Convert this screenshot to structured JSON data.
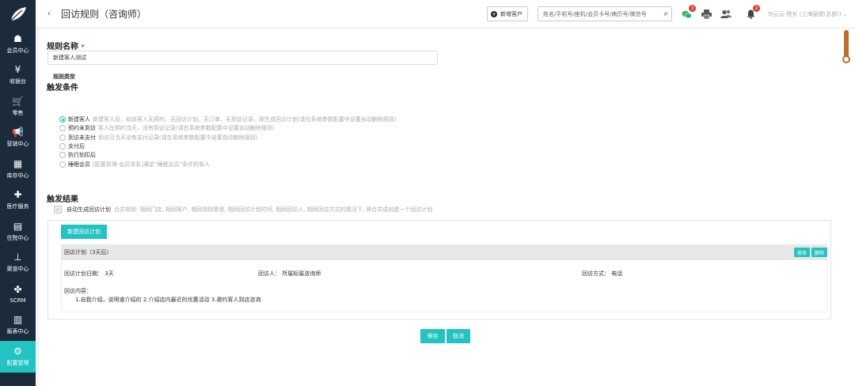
{
  "header": {
    "title": "回访规则（咨询师）",
    "new_customer_label": "新增客户",
    "search_placeholder": "姓名/手机号/座机/会员卡号/病历号/微信号",
    "badges": {
      "wechat": "3",
      "bell": "2"
    },
    "user": "刘云云-院长 (上海丽健(总部))"
  },
  "sidebar": {
    "items": [
      {
        "label": "会员中心",
        "icon": "member-icon",
        "glyph": "☗"
      },
      {
        "label": "收银台",
        "icon": "cashier-icon",
        "glyph": "¥"
      },
      {
        "label": "零售",
        "icon": "cart-icon",
        "glyph": "🛒"
      },
      {
        "label": "营销中心",
        "icon": "megaphone-icon",
        "glyph": "📢"
      },
      {
        "label": "库存中心",
        "icon": "grid-icon",
        "glyph": "▦"
      },
      {
        "label": "医疗服务",
        "icon": "medkit-icon",
        "glyph": "✚"
      },
      {
        "label": "住院中心",
        "icon": "clipboard-icon",
        "glyph": "▤"
      },
      {
        "label": "渠道中心",
        "icon": "sitemap-icon",
        "glyph": "⊥"
      },
      {
        "label": "SCRM",
        "icon": "cluster-icon",
        "glyph": "✤"
      },
      {
        "label": "报表中心",
        "icon": "bar-chart-icon",
        "glyph": "▥"
      },
      {
        "label": "配置管理",
        "icon": "gear-icon",
        "glyph": "⚙"
      }
    ],
    "active_index": 10
  },
  "form": {
    "rule_name_label": "规则名称",
    "rule_name_value": "新建客人测试",
    "trigger_title": "触发条件",
    "rule_type_label": "规则类型",
    "options": [
      {
        "label": "新建客人",
        "desc": "新建客人后，如该客人无预约、无回访计划、无订单、无到访记录，则生成回访计划(请在系统参数配置中设置自动删除规则)",
        "checked": true
      },
      {
        "label": "预约未到访",
        "desc": "客人在预约当天，没有到访记录(请在系统参数配置中设置自动删除规则)",
        "checked": false
      },
      {
        "label": "到访未支付",
        "desc": "到访日当天没有支付记录(请在系统参数配置中设置自动删除规则)",
        "checked": false
      },
      {
        "label": "支付后",
        "desc": "",
        "checked": false
      },
      {
        "label": "执行划扣后",
        "desc": "",
        "checked": false
      },
      {
        "label": "睡眠会员",
        "desc": "[配置管理-会员体系]满足“睡眠会员”条件的客人",
        "checked": false
      }
    ],
    "result_title": "触发结果",
    "auto_label": "自动生成回访计划",
    "auto_desc": "合并规则: 相同门店, 相同客户, 相同规则类型, 相同回访计划时间, 相同回访人, 相同回访方式的情况下, 将合并成创建一个回访计划",
    "new_plan_label": "新建回访计划",
    "plan": {
      "title": "回访计划（3天后）",
      "edit_label": "修改",
      "delete_label": "删除",
      "date_label": "回访计划日期：",
      "date_value": "3天",
      "person_label": "回访人：",
      "person_value": "所属标属咨询师",
      "method_label": "回访方式：",
      "method_value": "电话",
      "content_label": "回访内容：",
      "content_value": "1.自我介绍，说明谁介绍的 2.介绍店内最近的优惠活动 3.邀约客人到店咨询"
    },
    "save_label": "保存",
    "cancel_label": "取消"
  },
  "colors": {
    "accent": "#22c3c0",
    "sidebar": "#1b2b3b",
    "badge": "#e53935"
  }
}
